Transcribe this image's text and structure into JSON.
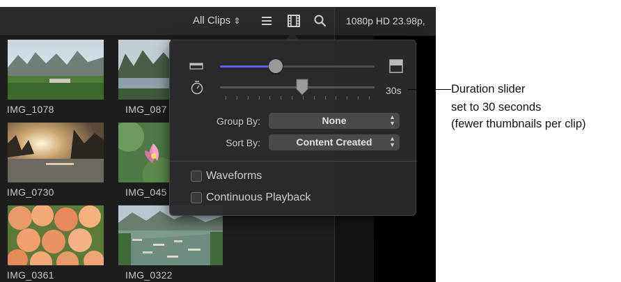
{
  "toolbar": {
    "clip_filter": "All Clips",
    "clip_filter_arrows": "⌃⌄",
    "video_format": "1080p HD 23.98p,"
  },
  "icons": {
    "list_view": "list-view-icon",
    "filmstrip_view": "filmstrip-view-icon",
    "search": "search-icon",
    "small_thumb": "small-thumbnail-icon",
    "large_thumb": "large-thumbnail-icon",
    "duration": "stopwatch-icon"
  },
  "clips": [
    {
      "label": "IMG_1078"
    },
    {
      "label": "IMG_087"
    },
    {
      "label": "IMG_0730"
    },
    {
      "label": "IMG_045"
    },
    {
      "label": "IMG_0361"
    },
    {
      "label": "IMG_0322"
    }
  ],
  "popover": {
    "thumb_size_level": 0.36,
    "duration_level": 0.53,
    "duration_value": "30s",
    "group_by_label": "Group By:",
    "group_by_value": "None",
    "sort_by_label": "Sort By:",
    "sort_by_value": "Content Created",
    "waveforms_label": "Waveforms",
    "waveforms_checked": false,
    "continuous_playback_label": "Continuous Playback",
    "continuous_playback_checked": false
  },
  "callout": {
    "line1": "Duration slider",
    "line2": "set to 30 seconds",
    "line3": "(fewer thumbnails per clip)"
  },
  "colors": {
    "accent": "#5b5ef0",
    "panel": "#2a2a2c"
  }
}
